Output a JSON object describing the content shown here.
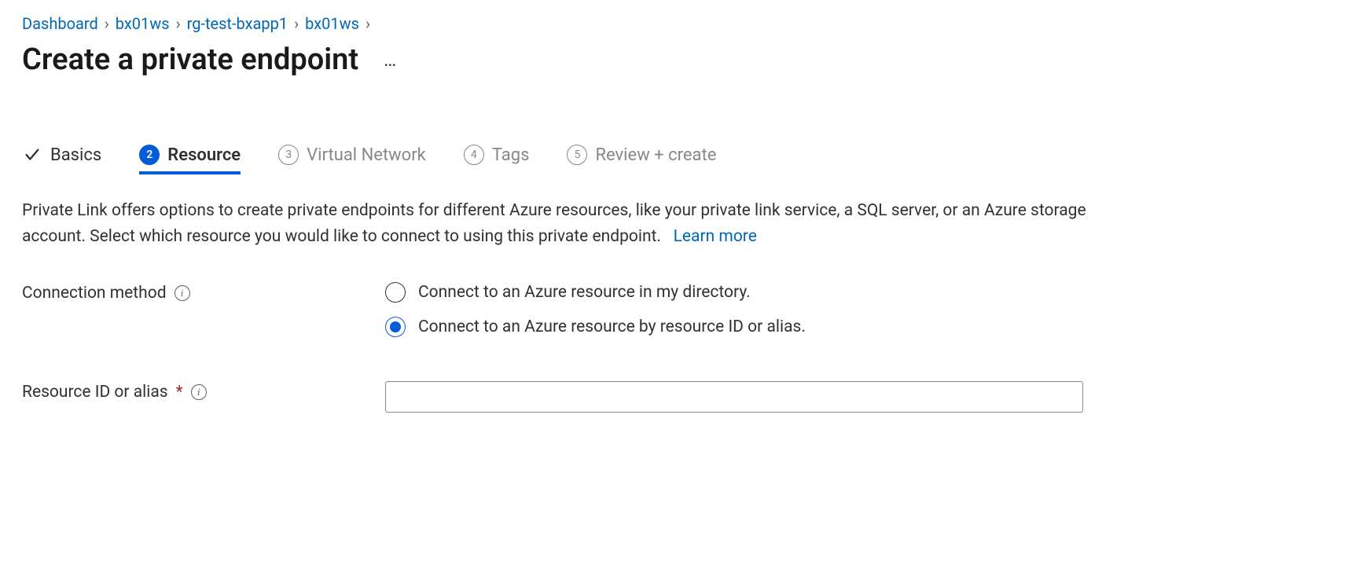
{
  "breadcrumb": {
    "items": [
      "Dashboard",
      "bx01ws",
      "rg-test-bxapp1",
      "bx01ws"
    ]
  },
  "page": {
    "title": "Create a private endpoint"
  },
  "stepper": {
    "steps": [
      {
        "num": "1",
        "label": "Basics",
        "state": "completed"
      },
      {
        "num": "2",
        "label": "Resource",
        "state": "active"
      },
      {
        "num": "3",
        "label": "Virtual Network",
        "state": "pending"
      },
      {
        "num": "4",
        "label": "Tags",
        "state": "pending"
      },
      {
        "num": "5",
        "label": "Review + create",
        "state": "pending"
      }
    ]
  },
  "description": {
    "text": "Private Link offers options to create private endpoints for different Azure resources, like your private link service, a SQL server, or an Azure storage account. Select which resource you would like to connect to using this private endpoint.",
    "learn_more": "Learn more"
  },
  "form": {
    "connection_method": {
      "label": "Connection method",
      "options": [
        "Connect to an Azure resource in my directory.",
        "Connect to an Azure resource by resource ID or alias."
      ],
      "selected_index": 1
    },
    "resource_id": {
      "label": "Resource ID or alias",
      "required_marker": "*",
      "value": ""
    }
  }
}
